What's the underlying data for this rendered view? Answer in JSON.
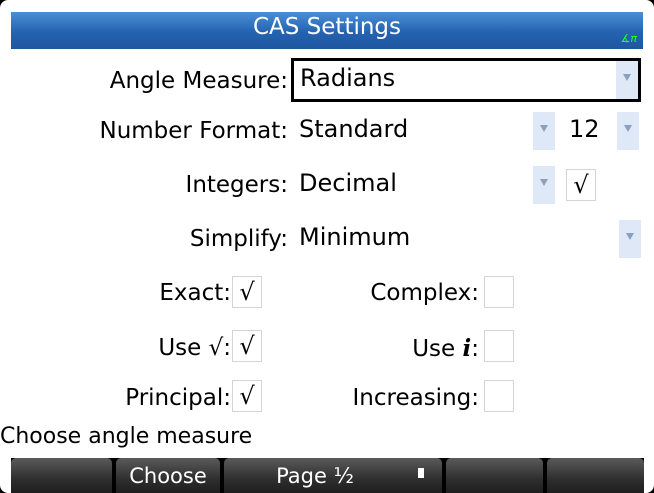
{
  "title": "CAS Settings",
  "angle_indicator": "∡π",
  "fields": {
    "angle_measure": {
      "label": "Angle Measure:",
      "value": "Radians"
    },
    "number_format": {
      "label": "Number Format:",
      "value": "Standard",
      "digits": "12"
    },
    "integers": {
      "label": "Integers:",
      "value": "Decimal",
      "checked": "√"
    },
    "simplify": {
      "label": "Simplify:",
      "value": "Minimum"
    }
  },
  "checkboxes": {
    "exact": {
      "label": "Exact:",
      "mark": "√"
    },
    "complex": {
      "label": "Complex:",
      "mark": ""
    },
    "use_sqrt": {
      "label": "Use √:",
      "mark": "√"
    },
    "use_i": {
      "label_prefix": "Use ",
      "label_symbol": "i",
      "label_suffix": ":",
      "mark": ""
    },
    "principal": {
      "label": "Principal:",
      "mark": "√"
    },
    "increasing": {
      "label": "Increasing:",
      "mark": ""
    }
  },
  "status_text": "Choose angle measure",
  "menu": {
    "button1": "",
    "choose": "Choose",
    "page": "Page ½",
    "button4": "",
    "button5": "",
    "button6": ""
  },
  "colors": {
    "title_bar": "#2462b0",
    "selection_border": "#000000",
    "dropdown_arrow_bg": "#dfe8f7"
  }
}
